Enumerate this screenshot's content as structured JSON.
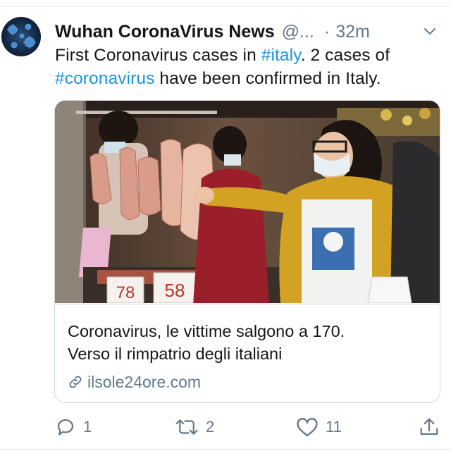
{
  "tweet": {
    "author_name": "Wuhan CoronaVirus News",
    "handle": "@...",
    "separator": "·",
    "time": "32m",
    "text_part1": "First Coronavirus cases in ",
    "hashtag1": "#italy",
    "text_part2": ". 2 cases of ",
    "hashtag2": "#coronavirus",
    "text_part3": " have been confirmed in Italy."
  },
  "card": {
    "title_line1": "Coronavirus, le vittime salgono a 170.",
    "title_line2": "Verso il rimpatrio degli italiani",
    "domain": "ilsole24ore.com",
    "price_tag_1": "78",
    "price_tag_2": "58"
  },
  "actions": {
    "reply_count": "1",
    "retweet_count": "2",
    "like_count": "11"
  },
  "colors": {
    "accent": "#1b95e0",
    "secondary_text": "#657786",
    "primary_text": "#14171a",
    "border": "#ccd6dd"
  },
  "icons": [
    "virus-avatar",
    "chevron-down-icon",
    "link-icon",
    "reply-icon",
    "retweet-icon",
    "like-icon",
    "share-icon"
  ]
}
